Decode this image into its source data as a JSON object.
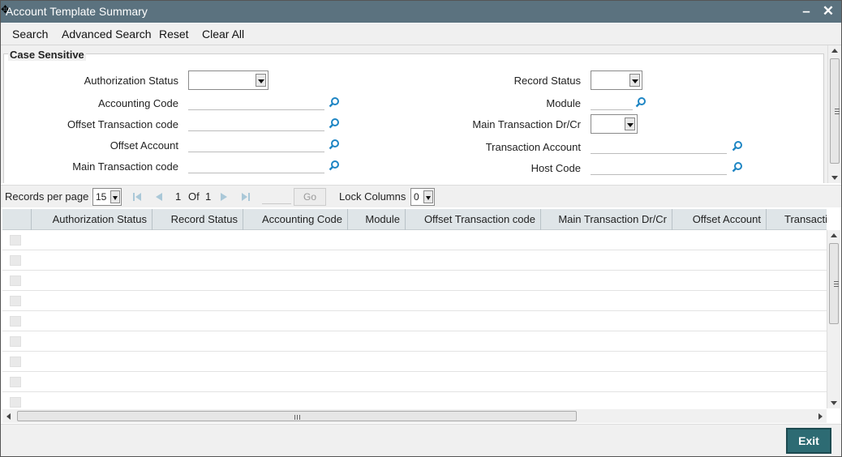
{
  "window": {
    "title": "Account Template Summary",
    "minimize_icon": "minimize-icon",
    "close_icon": "close-icon"
  },
  "menu": {
    "search": "Search",
    "advanced_search": "Advanced Search",
    "reset": "Reset",
    "clear_all": "Clear All"
  },
  "criteria": {
    "legend": "Case Sensitive",
    "fields": {
      "authorization_status": {
        "label": "Authorization Status",
        "value": ""
      },
      "accounting_code": {
        "label": "Accounting Code",
        "value": ""
      },
      "offset_transaction_code": {
        "label": "Offset Transaction code",
        "value": ""
      },
      "offset_account": {
        "label": "Offset Account",
        "value": ""
      },
      "main_transaction_code": {
        "label": "Main Transaction code",
        "value": ""
      },
      "record_status": {
        "label": "Record Status",
        "value": ""
      },
      "module": {
        "label": "Module",
        "value": ""
      },
      "main_transaction_dr_cr": {
        "label": "Main Transaction Dr/Cr",
        "value": ""
      },
      "transaction_account": {
        "label": "Transaction Account",
        "value": ""
      },
      "host_code": {
        "label": "Host Code",
        "value": ""
      }
    }
  },
  "pager": {
    "records_per_page_label": "Records per page",
    "records_per_page": "15",
    "current_page": "1",
    "of_label": "Of",
    "total_pages": "1",
    "go_label": "Go",
    "lock_columns_label": "Lock Columns",
    "lock_columns": "0"
  },
  "grid": {
    "columns": [
      "Authorization Status",
      "Record Status",
      "Accounting Code",
      "Module",
      "Offset Transaction code",
      "Main Transaction Dr/Cr",
      "Offset Account",
      "Transaction Account"
    ],
    "empty_rows": 9
  },
  "footer": {
    "exit": "Exit"
  },
  "colors": {
    "titlebar": "#5b727f",
    "exit_button": "#2d6b73",
    "lookup_icon": "#1f86c4",
    "grid_header": "#dfe5e8"
  }
}
